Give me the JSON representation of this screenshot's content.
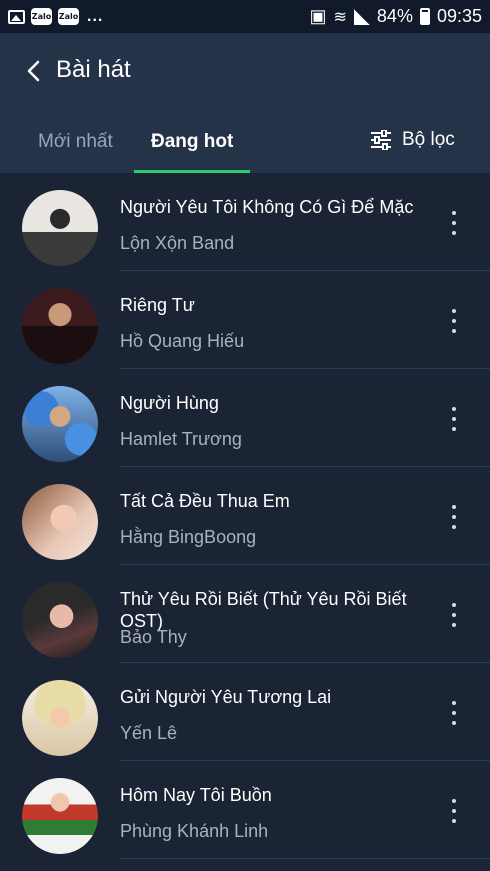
{
  "status_bar": {
    "zalo1": "Zalo",
    "zalo2": "Zalo",
    "more": "...",
    "battery_pct": "84%",
    "time": "09:35"
  },
  "header": {
    "title": "Bài hát",
    "tabs": [
      {
        "label": "Mới nhất",
        "active": false
      },
      {
        "label": "Đang hot",
        "active": true
      }
    ],
    "filter_label": "Bộ lọc",
    "accent_color": "#2ecc71"
  },
  "songs": [
    {
      "title": "Người Yêu Tôi Không Có Gì Để Mặc",
      "artist": "Lộn Xộn Band"
    },
    {
      "title": "Riêng Tư",
      "artist": "Hồ Quang Hiếu"
    },
    {
      "title": "Người Hùng",
      "artist": "Hamlet Trương"
    },
    {
      "title": "Tất Cả Đều Thua Em",
      "artist": "Hằng BingBoong"
    },
    {
      "title": "Thử Yêu Rồi Biết (Thử Yêu Rồi Biết OST)",
      "artist": "Bảo Thy"
    },
    {
      "title": "Gửi Người Yêu Tương Lai",
      "artist": "Yến Lê"
    },
    {
      "title": "Hôm Nay Tôi Buồn",
      "artist": "Phùng Khánh Linh"
    }
  ]
}
